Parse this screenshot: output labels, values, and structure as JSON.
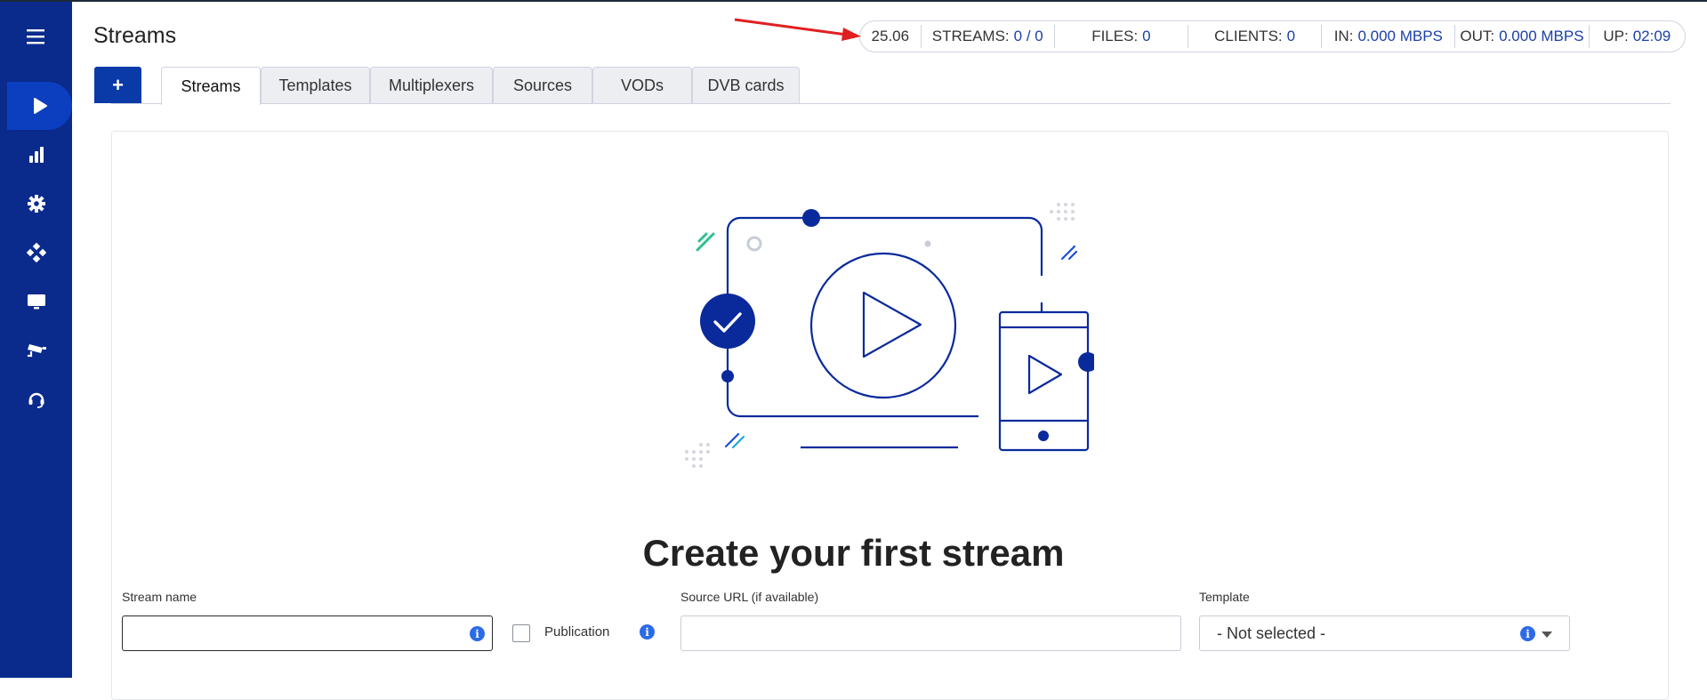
{
  "header": {
    "title": "Streams"
  },
  "stats": {
    "version": "25.06",
    "streams_label": "STREAMS:",
    "streams_value": "0 / 0",
    "files_label": "FILES:",
    "files_value": "0",
    "clients_label": "CLIENTS:",
    "clients_value": "0",
    "in_label": "IN:",
    "in_value": "0.000 MBPS",
    "out_label": "OUT:",
    "out_value": "0.000 MBPS",
    "up_label": "UP:",
    "up_value": "02:09"
  },
  "sidebar": {
    "items": [
      {
        "icon": "menu-icon"
      },
      {
        "icon": "play-icon",
        "active": true
      },
      {
        "icon": "chart-icon"
      },
      {
        "icon": "gear-icon"
      },
      {
        "icon": "plugin-icon"
      },
      {
        "icon": "monitor-icon"
      },
      {
        "icon": "camera-icon"
      },
      {
        "icon": "headset-icon"
      }
    ]
  },
  "tabs": {
    "add_label": "+",
    "items": [
      "Streams",
      "Templates",
      "Multiplexers",
      "Sources",
      "VODs",
      "DVB cards"
    ],
    "active": "Streams"
  },
  "empty_state": {
    "headline": "Create your first stream"
  },
  "form": {
    "stream_name_label": "Stream name",
    "stream_name_value": "",
    "publication_label": "Publication",
    "source_url_label": "Source URL (if available)",
    "source_url_value": "",
    "template_label": "Template",
    "template_value": "- Not selected -"
  },
  "colors": {
    "sidebar": "#0a2a8c",
    "accent": "#0a3aa8",
    "value_text": "#1a3fa8",
    "annotation_arrow": "#e02020"
  }
}
